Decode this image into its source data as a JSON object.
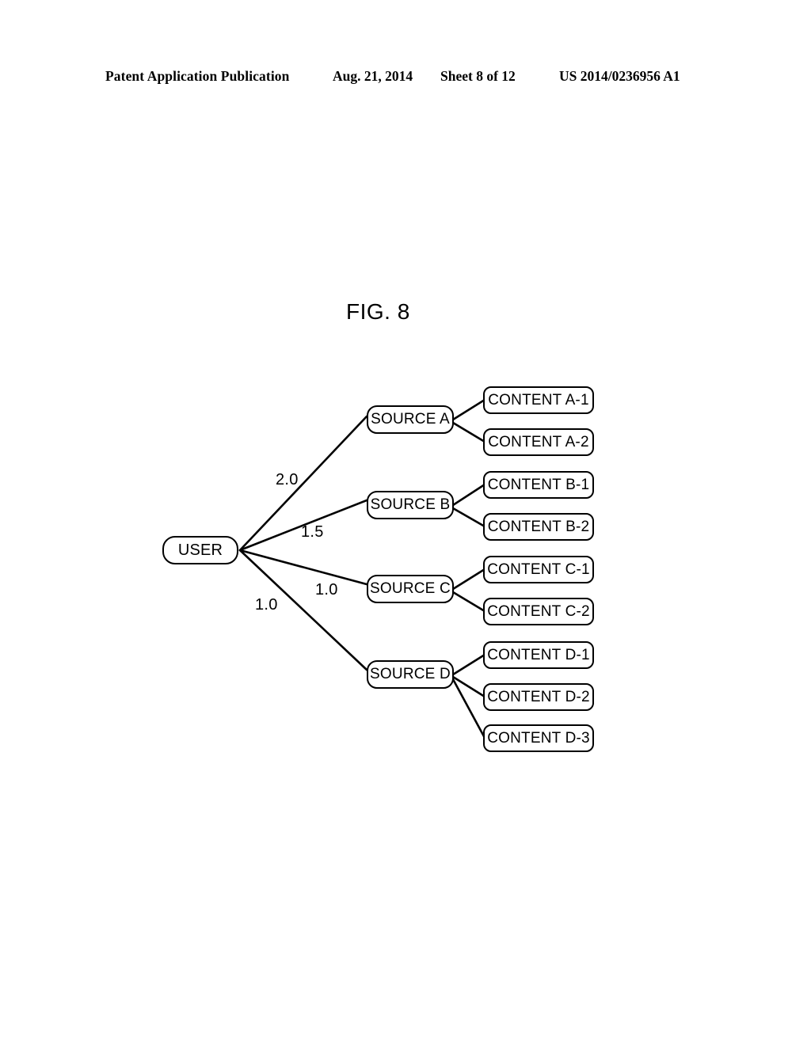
{
  "header": {
    "publication": "Patent Application Publication",
    "date": "Aug. 21, 2014",
    "sheet": "Sheet 8 of 12",
    "number": "US 2014/0236956 A1"
  },
  "figure": {
    "title": "FIG. 8"
  },
  "chart_data": {
    "type": "diagram",
    "title": "FIG. 8",
    "description": "User-to-source-to-content weighted tree graph",
    "root": {
      "id": "user",
      "label": "USER"
    },
    "edge_weight_labels": [
      "2.0",
      "1.5",
      "1.0",
      "1.0"
    ],
    "sources": [
      {
        "id": "source-a",
        "label": "SOURCE A",
        "weight": "2.0",
        "contents": [
          {
            "id": "content-a-1",
            "label": "CONTENT A-1"
          },
          {
            "id": "content-a-2",
            "label": "CONTENT A-2"
          }
        ]
      },
      {
        "id": "source-b",
        "label": "SOURCE B",
        "weight": "1.5",
        "contents": [
          {
            "id": "content-b-1",
            "label": "CONTENT B-1"
          },
          {
            "id": "content-b-2",
            "label": "CONTENT B-2"
          }
        ]
      },
      {
        "id": "source-c",
        "label": "SOURCE C",
        "weight": "1.0",
        "contents": [
          {
            "id": "content-c-1",
            "label": "CONTENT C-1"
          },
          {
            "id": "content-c-2",
            "label": "CONTENT C-2"
          }
        ]
      },
      {
        "id": "source-d",
        "label": "SOURCE D",
        "weight": "1.0",
        "contents": [
          {
            "id": "content-d-1",
            "label": "CONTENT D-1"
          },
          {
            "id": "content-d-2",
            "label": "CONTENT D-2"
          },
          {
            "id": "content-d-3",
            "label": "CONTENT D-3"
          }
        ]
      }
    ],
    "colors": {
      "stroke": "#000000",
      "background": "#ffffff",
      "text": "#000000"
    }
  }
}
